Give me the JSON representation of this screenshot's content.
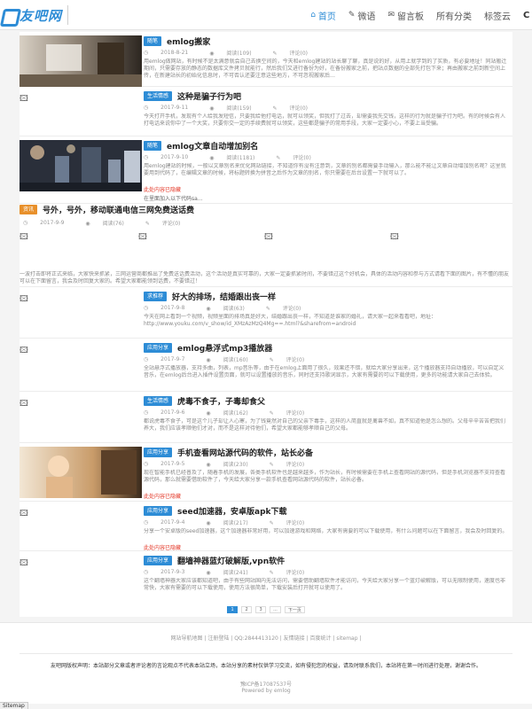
{
  "site": {
    "logo_text": "友吧网"
  },
  "nav": {
    "items": [
      {
        "icon": "⌂",
        "label": "首页"
      },
      {
        "icon": "✎",
        "label": "微语"
      },
      {
        "icon": "✉",
        "label": "留言板"
      },
      {
        "icon": "",
        "label": "所有分类"
      },
      {
        "icon": "",
        "label": "标签云"
      },
      {
        "icon": "",
        "label": "C"
      }
    ]
  },
  "colors": {
    "accent": "#2d8cd6",
    "read_more": "#e43a2a",
    "tag_orange": "#e8902b"
  },
  "icons": {
    "broken_image": "🖾",
    "date": "◷",
    "views": "◉",
    "comments": "✎"
  },
  "posts": [
    {
      "category": "随笔",
      "title": "emlog搬家",
      "date": "2018-8-21",
      "views": "阅读(109)",
      "comments": "评论(0)",
      "excerpt": "用emlog做网站，有时候不是太满意就会自己去换空间的，今天和emlog建站的站长聊了聊，真是说的好，从用上就学到的了实质，有必要地址！同站搬迁期间，只需要存放的静态的数据库文件拷贝就能行，然后我们又进行备份为好，在备份搬家之前，把站点数据的全部先打包下来；再由搬家之前到新空间上传，在新建站长的初始化信息时，不可否认还要注意这些地方，不可忽视搬家后…",
      "read_more": "",
      "tags": ""
    },
    {
      "category": "生活情感",
      "title": "这种是骗子行为吧",
      "date": "2017-9-11",
      "views": "阅读(159)",
      "comments": "评论(0)",
      "excerpt": "今天打开手机，发现有个人给我发短信，只要我给他打电话，就可以领奖，但我打了过去，却需要我先交钱，这样的行为就是骗子行为吧。有的时候会有人打电话来说你中了一个大奖，只要你交一定的手续费就可以领奖，这些都是骗子的常用手段，大家一定要小心，不要上当受骗。",
      "read_more": "",
      "tags": ""
    },
    {
      "category": "随笔",
      "title": "emlog文章自动增加别名",
      "date": "2017-9-10",
      "views": "阅读(1181)",
      "comments": "评论(0)",
      "excerpt": "用emlog建站的时候，一般以文章别名来优化网站链接，不知道你有没有注意到，文章的别名都需要手动输入，那么能不能让文章自动增加别名呢？这里就要用到代码了，在编辑文章的时候，将标题转换为拼音之后作为文章的别名，你只需要在后台设置一下就可以了。",
      "read_more": "此处内容已隐藏",
      "tags": "在里面加入以下代码sa..."
    }
  ],
  "full_post": {
    "category": "资讯",
    "title": "号外，号外，移动联通电信三网免费送话费",
    "date": "2017-9-9",
    "views": "阅读(76)",
    "comments": "评论(0)",
    "text": "一波打击即将正式来临，大家快来抓紧，三网运营商都推出了免费送话费活动，这个活动是真实可靠的，大家一定要抓紧时间，不要错过这个好机会，具体的活动内容和参与方式请看下面的图片，有不懂的朋友可以在下面留言，我会及时回复大家的。希望大家都能领到话费，不要错过！"
  },
  "posts2": [
    {
      "category": "求推荐",
      "title": "好大的排场，结婚跟出丧一样",
      "date": "2017-9-8",
      "views": "阅读(63)",
      "comments": "评论(0)",
      "excerpt": "今天在网上看到一个视频，视频里面的排场真是好大，结婚跟出丧一样，不知道是谁家的婚礼，请大家一起来看看吧，地址：http://www.youku.com/v_show/id_XMzAzMzQ4Mg==.html?&sharefrom=android",
      "read_more": "",
      "tags": ""
    },
    {
      "category": "应用分享",
      "title": "emlog悬浮式mp3播放器",
      "date": "2017-9-7",
      "views": "阅读(160)",
      "comments": "评论(0)",
      "excerpt": "全站悬浮式播放器，支持多曲，列表，mp音乐等，由于在emlog上面用了很久，效果还不错，就给大家分享出来，这个播放器支持自动播放，可以自定义音乐，在emlog后台进入插件设置页面，就可以设置播放的音乐，同时还支持歌词显示，大家有需要的可以下载使用，更多的功能请大家自己去体验。",
      "read_more": "",
      "tags": ""
    },
    {
      "category": "生活情感",
      "title": "虎毒不食子，子毒却食父",
      "date": "2017-9-6",
      "views": "阅读(162)",
      "comments": "评论(0)",
      "excerpt": "都说虎毒不食子，可是这个儿子却让人心寒，为了钱竟然对自己的父亲下毒手，这样的人简直就是禽兽不如，真不知道他是怎么想的。父母辛辛苦苦把我们养大，我们应该孝顺他们才对，而不是这样对待他们，希望大家都能够孝顺自己的父母。",
      "read_more": "",
      "tags": ""
    },
    {
      "category": "应用分享",
      "title": "手机查看网站源代码的软件，站长必备",
      "date": "2017-9-5",
      "views": "阅读(230)",
      "comments": "评论(0)",
      "excerpt": "现在智能手机已经普及了，随着手机的发展，各类手机软件也是越来越多，作为站长，有时候需要在手机上查看网站的源代码，但是手机浏览器不支持查看源代码，那么就需要借助软件了，今天给大家分享一款手机查看网站源代码的软件，站长必备。",
      "read_more": "此处内容已隐藏",
      "tags": ""
    },
    {
      "category": "应用分享",
      "title": "seed加速器，安卓版apk下载",
      "date": "2017-9-4",
      "views": "阅读(217)",
      "comments": "评论(0)",
      "excerpt": "分享一个安卓版的seed加速器，这个加速器非常好用，可以加速游戏和网络，大家有需要的可以下载使用，有什么问题可以在下面留言，我会及时回复的。",
      "read_more": "此处内容已隐藏",
      "tags": ""
    },
    {
      "category": "应用分享",
      "title": "翻墙神器蓝灯破解版,vpn软件",
      "date": "2017-9-3",
      "views": "阅读(241)",
      "comments": "评论(0)",
      "excerpt": "这个翻墙神器大家应该都知道吧，由于有些网站国内无法访问，需要借助翻墙软件才能访问，今天给大家分享一个蓝灯破解版，可以无限制使用，速度也非常快，大家有需要的可以下载使用，使用方法很简单，下载安装后打开就可以使用了。",
      "read_more": "",
      "tags": ""
    }
  ],
  "pagination": {
    "pages": [
      "1",
      "2",
      "3",
      "..."
    ],
    "next": "下一页"
  },
  "footer": {
    "links": "网站导航地图 | 注册登陆 | QQ:2844413120 | 友情链接 | 百度统计 | sitemap |",
    "disclaimer": "友吧网版权声明：本站部分文章或者评论者的言论观点不代表本站立场，本站分享的素材仅供学习交流，如有侵犯您的权益，请及时联系我们，本站将在第一时间进行处理，谢谢合作。",
    "icp": "豫ICP备17087537号",
    "powered": "Powered by emlog"
  },
  "status_bar": "Sitemap"
}
